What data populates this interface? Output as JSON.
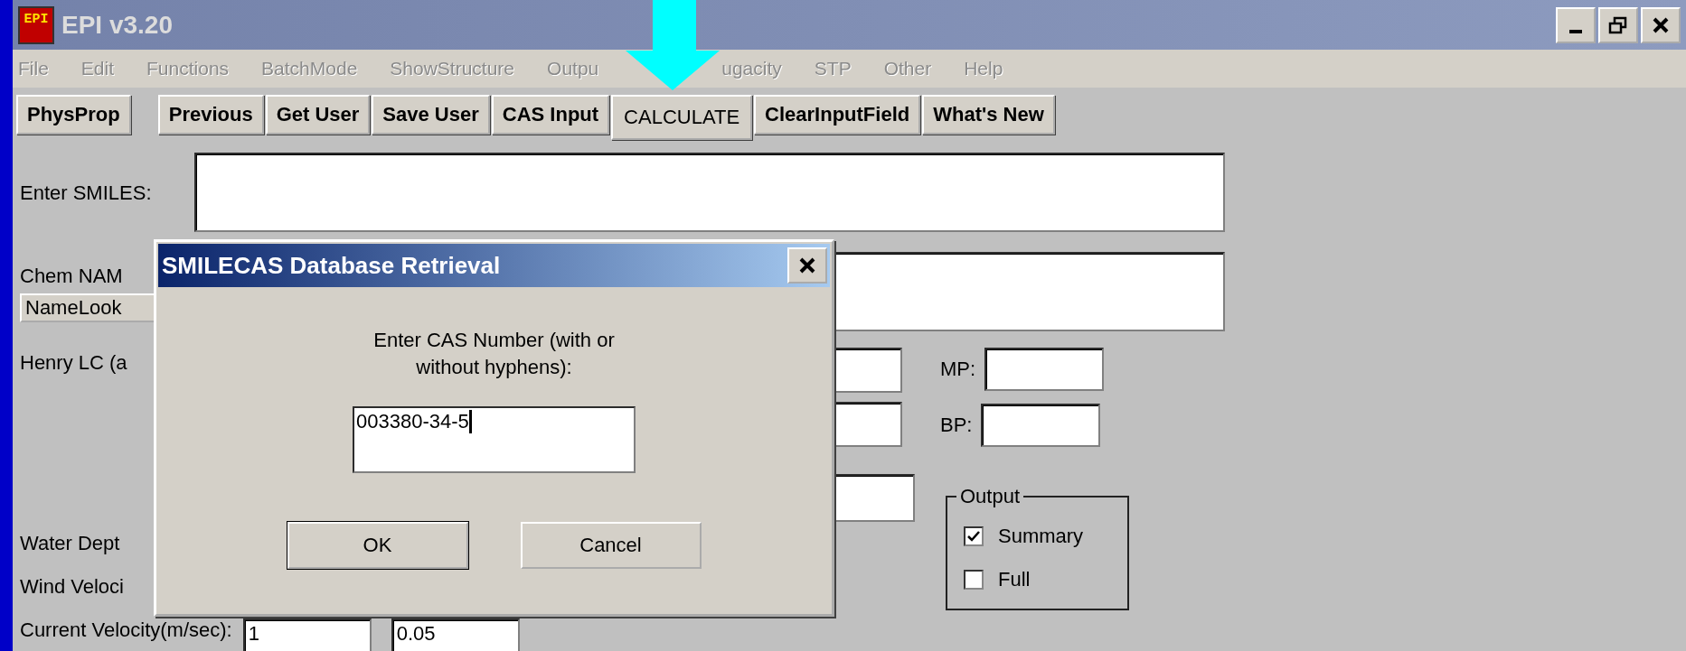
{
  "window": {
    "title": "EPI v3.20",
    "icon_label": "EPI"
  },
  "menu": [
    {
      "label": "File"
    },
    {
      "label": "Edit"
    },
    {
      "label": "Functions"
    },
    {
      "label": "BatchMode"
    },
    {
      "label": "ShowStructure"
    },
    {
      "label": "Outpu"
    },
    {
      "label": "ugacity",
      "after_gap": true
    },
    {
      "label": "STP"
    },
    {
      "label": "Other"
    },
    {
      "label": "Help"
    }
  ],
  "toolbar": [
    {
      "label": "PhysProp",
      "kind": "spaced"
    },
    {
      "label": "Previous",
      "kind": "normal"
    },
    {
      "label": "Get User",
      "kind": "normal"
    },
    {
      "label": "Save User",
      "kind": "normal"
    },
    {
      "label": "CAS Input",
      "kind": "normal"
    },
    {
      "label": "CALCULATE",
      "kind": "tall"
    },
    {
      "label": "ClearInputField",
      "kind": "normal"
    },
    {
      "label": "What's New",
      "kind": "normal"
    }
  ],
  "form": {
    "smiles_label": "Enter SMILES:",
    "name_label": "Chem NAM",
    "name_lookup": "NameLook",
    "henry_label": "Henry LC (a",
    "mp_label": "MP:",
    "bp_label": "BP:",
    "water_label": "Water Dept",
    "wind_label": "Wind Veloci",
    "current_label": "Current Velocity(m/sec):",
    "current_value": "1",
    "current_value_2": "0.05"
  },
  "output": {
    "title": "Output",
    "options": [
      {
        "label": "Summary",
        "checked": true
      },
      {
        "label": "Full",
        "checked": false
      }
    ]
  },
  "dialog": {
    "title": "SMILECAS Database Retrieval",
    "prompt": "Enter CAS Number (with or without hyphens):",
    "value": "003380-34-5",
    "buttons": [
      "OK",
      "Cancel"
    ]
  }
}
